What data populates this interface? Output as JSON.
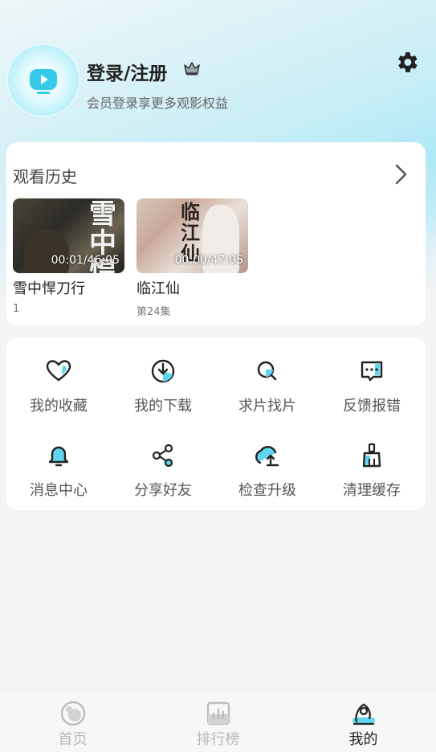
{
  "header": {
    "login_title": "登录/注册",
    "login_subtitle": "会员登录享更多观影权益",
    "settings_icon": "gear-icon",
    "vip_icon": "crown-icon"
  },
  "history": {
    "title": "观看历史",
    "items": [
      {
        "title": "雪中悍刀行",
        "subtitle": "1",
        "progress": "00:01/46:05",
        "poster_text": "雪中悍刀行"
      },
      {
        "title": "临江仙",
        "subtitle": "第24集",
        "progress": "00:00/47:05",
        "poster_text": "临江仙"
      }
    ]
  },
  "features": [
    {
      "label": "我的收藏",
      "icon": "heart-icon"
    },
    {
      "label": "我的下载",
      "icon": "download-icon"
    },
    {
      "label": "求片找片",
      "icon": "search-icon"
    },
    {
      "label": "反馈报错",
      "icon": "feedback-icon"
    },
    {
      "label": "消息中心",
      "icon": "bell-icon"
    },
    {
      "label": "分享好友",
      "icon": "share-icon"
    },
    {
      "label": "检查升级",
      "icon": "upgrade-icon"
    },
    {
      "label": "清理缓存",
      "icon": "broom-icon"
    }
  ],
  "tabbar": {
    "tabs": [
      {
        "label": "首页",
        "icon": "home-icon",
        "active": false
      },
      {
        "label": "排行榜",
        "icon": "ranking-icon",
        "active": false
      },
      {
        "label": "我的",
        "icon": "profile-icon",
        "active": true
      }
    ]
  },
  "colors": {
    "accent": "#5fd6ee",
    "background": "#f4f4f6",
    "text": "#222222"
  }
}
